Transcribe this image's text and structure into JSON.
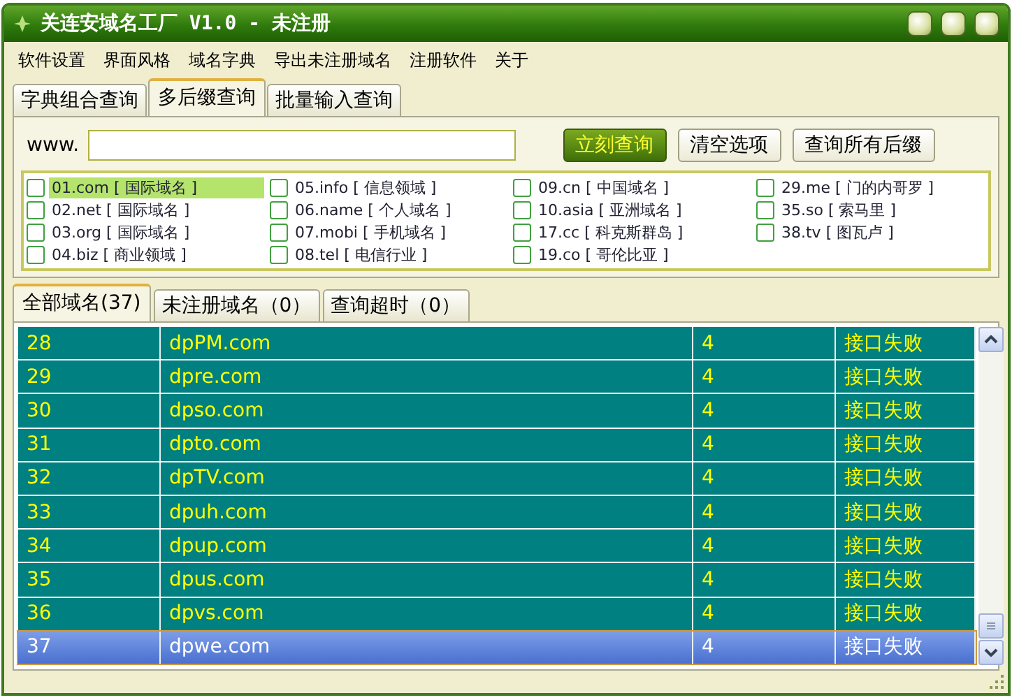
{
  "window": {
    "title": "关连安域名工厂 V1.0 - 未注册"
  },
  "menu": [
    "软件设置",
    "界面风格",
    "域名字典",
    "导出未注册域名",
    "注册软件",
    "关于"
  ],
  "tabs": [
    {
      "label": "字典组合查询",
      "selected": false
    },
    {
      "label": "多后缀查询",
      "selected": true
    },
    {
      "label": "批量输入查询",
      "selected": false
    }
  ],
  "query": {
    "prefix": "www.",
    "buttons": [
      {
        "label": "立刻查询",
        "primary": true
      },
      {
        "label": "清空选项",
        "primary": false
      },
      {
        "label": "查询所有后缀",
        "primary": false
      }
    ]
  },
  "suffixes": [
    [
      {
        "label": "01.com [ 国际域名 ]",
        "checked": false,
        "selected": true
      },
      {
        "label": "02.net [ 国际域名 ]",
        "checked": false,
        "selected": false
      },
      {
        "label": "03.org [ 国际域名 ]",
        "checked": false,
        "selected": false
      },
      {
        "label": "04.biz [ 商业领域 ]",
        "checked": false,
        "selected": false
      }
    ],
    [
      {
        "label": "05.info [ 信息领域 ]",
        "checked": false,
        "selected": false
      },
      {
        "label": "06.name [ 个人域名 ]",
        "checked": false,
        "selected": false
      },
      {
        "label": "07.mobi [ 手机域名 ]",
        "checked": false,
        "selected": false
      },
      {
        "label": "08.tel [ 电信行业 ]",
        "checked": false,
        "selected": false
      }
    ],
    [
      {
        "label": "09.cn [ 中国域名 ]",
        "checked": false,
        "selected": false
      },
      {
        "label": "10.asia [ 亚洲域名 ]",
        "checked": false,
        "selected": false
      },
      {
        "label": "17.cc [ 科克斯群岛 ]",
        "checked": false,
        "selected": false
      },
      {
        "label": "19.co [ 哥伦比亚 ]",
        "checked": false,
        "selected": false
      }
    ],
    [
      {
        "label": "29.me [ 门的内哥罗 ]",
        "checked": false,
        "selected": false
      },
      {
        "label": "35.so [ 索马里 ]",
        "checked": false,
        "selected": false
      },
      {
        "label": "38.tv [ 图瓦卢 ]",
        "checked": false,
        "selected": false
      }
    ]
  ],
  "result_tabs": [
    {
      "label": "全部域名(37)",
      "selected": true
    },
    {
      "label": "未注册域名（0）",
      "selected": false
    },
    {
      "label": "查询超时（0）",
      "selected": false
    }
  ],
  "rows": [
    {
      "cells": [
        "28",
        "dpPM.com",
        "4",
        "接口失败"
      ],
      "selected": false
    },
    {
      "cells": [
        "29",
        "dpre.com",
        "4",
        "接口失败"
      ],
      "selected": false
    },
    {
      "cells": [
        "30",
        "dpso.com",
        "4",
        "接口失败"
      ],
      "selected": false
    },
    {
      "cells": [
        "31",
        "dpto.com",
        "4",
        "接口失败"
      ],
      "selected": false
    },
    {
      "cells": [
        "32",
        "dpTV.com",
        "4",
        "接口失败"
      ],
      "selected": false
    },
    {
      "cells": [
        "33",
        "dpuh.com",
        "4",
        "接口失败"
      ],
      "selected": false
    },
    {
      "cells": [
        "34",
        "dpup.com",
        "4",
        "接口失败"
      ],
      "selected": false
    },
    {
      "cells": [
        "35",
        "dpus.com",
        "4",
        "接口失败"
      ],
      "selected": false
    },
    {
      "cells": [
        "36",
        "dpvs.com",
        "4",
        "接口失败"
      ],
      "selected": false
    },
    {
      "cells": [
        "37",
        "dpwe.com",
        "4",
        "接口失败"
      ],
      "selected": true
    }
  ]
}
